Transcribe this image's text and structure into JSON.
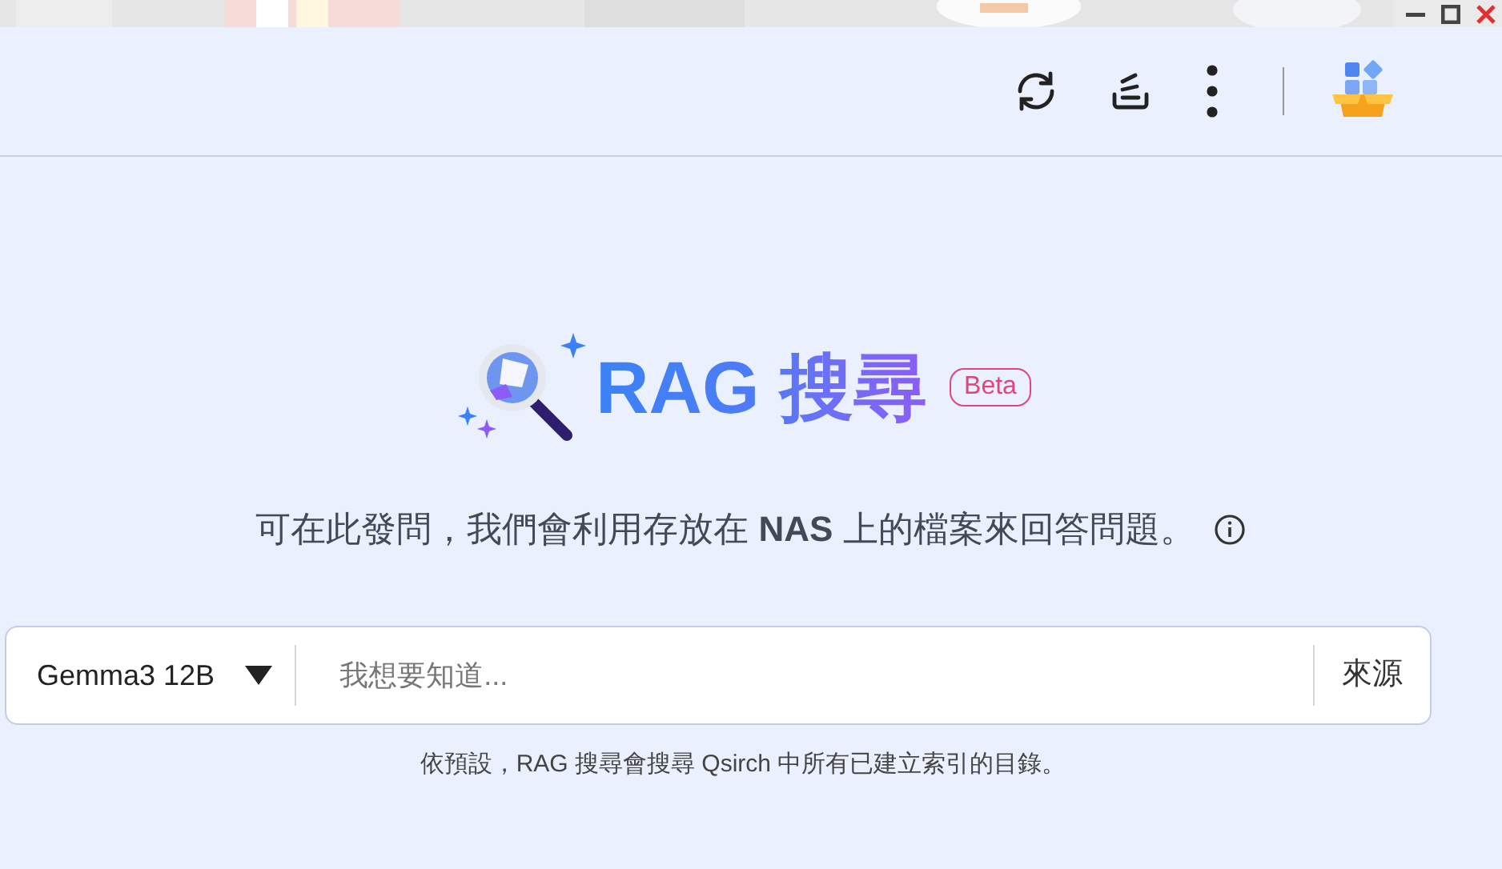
{
  "title": {
    "text": "RAG 搜尋",
    "badge": "Beta"
  },
  "description": "可在此發問，我們會利用存放在 **NAS** 上的檔案來回答問題。",
  "search": {
    "model": "Gemma3 12B",
    "placeholder": "我想要知道...",
    "source_button": "來源"
  },
  "note": "依預設，RAG 搜尋會搜尋 Qsirch 中所有已建立索引的目錄。"
}
